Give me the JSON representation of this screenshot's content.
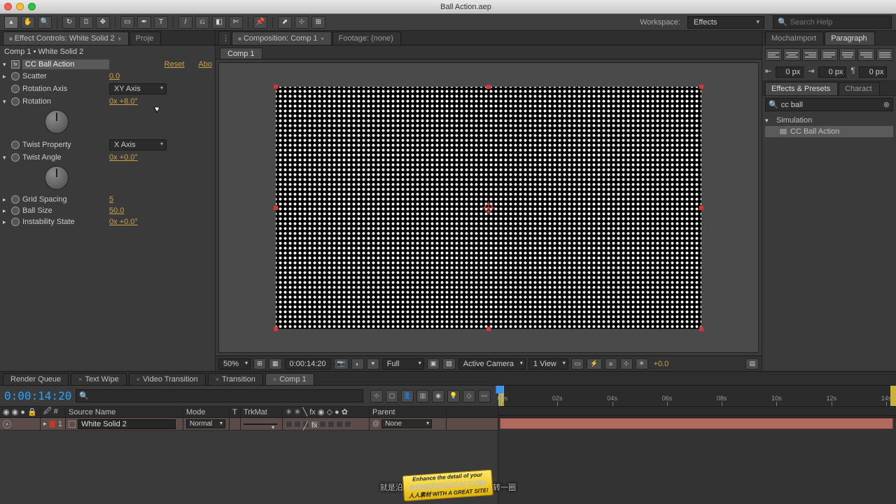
{
  "window_title": "Ball Action.aep",
  "workspace": {
    "label": "Workspace:",
    "value": "Effects"
  },
  "search_help_placeholder": "Search Help",
  "left_tabs": {
    "effect_controls": "Effect Controls: White Solid 2",
    "project": "Proje"
  },
  "ec": {
    "path": "Comp 1 • White Solid 2",
    "effect_name": "CC Ball Action",
    "reset": "Reset",
    "about": "Abo",
    "scatter": {
      "label": "Scatter",
      "value": "0.0"
    },
    "rotation_axis": {
      "label": "Rotation Axis",
      "value": "XY Axis"
    },
    "rotation": {
      "label": "Rotation",
      "value": "0x +8.0°"
    },
    "twist_property": {
      "label": "Twist Property",
      "value": "X Axis"
    },
    "twist_angle": {
      "label": "Twist Angle",
      "value": "0x +0.0°"
    },
    "grid_spacing": {
      "label": "Grid Spacing",
      "value": "5"
    },
    "ball_size": {
      "label": "Ball Size",
      "value": "50.0"
    },
    "instability_state": {
      "label": "Instability State",
      "value": "0x +0.0°"
    }
  },
  "center_tabs": {
    "composition": "Composition: Comp 1",
    "footage": "Footage: (none)"
  },
  "inner_tab": "Comp 1",
  "viewer_footer": {
    "zoom": "50%",
    "timecode": "0:00:14:20",
    "resolution": "Full",
    "camera": "Active Camera",
    "views": "1 View",
    "exposure": "+0.0"
  },
  "right_tabs": {
    "mocha": "MochaImport",
    "paragraph": "Paragraph",
    "effects_presets": "Effects & Presets",
    "character": "Charact"
  },
  "paragraph": {
    "px1": "0 px",
    "px2": "0 px",
    "px3": "0 px"
  },
  "ep": {
    "search": "cc ball",
    "category": "Simulation",
    "item": "CC Ball Action"
  },
  "timeline_tabs": [
    "Render Queue",
    "Text Wipe",
    "Video Transition",
    "Transition",
    "Comp 1"
  ],
  "timeline": {
    "time": "0:00:14:20",
    "columns": {
      "num": "#",
      "source": "Source Name",
      "mode": "Mode",
      "t": "T",
      "trkmat": "TrkMat",
      "parent": "Parent"
    },
    "layer": {
      "num": "1",
      "name": "White Solid 2",
      "mode": "Normal",
      "trkmat": "",
      "parent": "None"
    },
    "ticks": [
      "00s",
      "02s",
      "04s",
      "06s",
      "08s",
      "10s",
      "12s",
      "14s"
    ]
  },
  "subtitle": "就是沿X轴旋转　　　　　　只旋转一圈",
  "watermark": {
    "line1": "Enhance the detail of your",
    "line2": "RENRENSUCAI.COM",
    "line3": "人人素材 WITH A GREAT SITE!"
  }
}
